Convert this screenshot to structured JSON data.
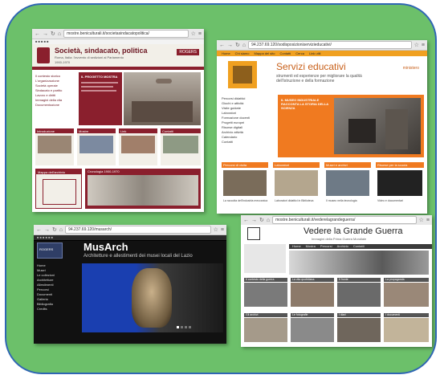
{
  "shots": {
    "politica": {
      "url": "mostre.beniculturali.it/societasindacatopolitica/",
      "title": "Società, sindacato, politica",
      "subtitle": "Roma, Italia: l'avvento di sedizioni al Parlamento",
      "years": "1900-1970",
      "logo": "ROGERS",
      "sidebar": [
        "Il contesto storico",
        "L'organizzazione",
        "Società operaie",
        "Sindacato e partito",
        "Lavoro e diritti",
        "Immagini della vita",
        "Documentazione"
      ],
      "box_title": "IL PROGETTO MOSTRA",
      "sections": [
        "Introduzione",
        "Mostre",
        "Link",
        "Contatti"
      ],
      "lower_left": "Mappa dell'archivio",
      "lower_right": "Cronologia 1900-1970"
    },
    "servizi": {
      "url": "94.237.69.120/sodisposizioniservizieducativi/",
      "title": "Servizi educativi",
      "subtitle": "strumenti ed esperienze per migliorare la qualità dell'istruzione e della formazione",
      "logo_text": "ministero",
      "menu": [
        "Home",
        "Chi siamo",
        "Mappa del sito",
        "Contatti",
        "Cerca",
        "Link utili"
      ],
      "sidebar": [
        "Percorsi didattici",
        "Giochi e attività",
        "Visite guidate",
        "Laboratori",
        "Formazione docenti",
        "Progetti europei",
        "Risorse digitali",
        "Archivio attività",
        "Calendario",
        "Contatti"
      ],
      "banner": "IL MUSEO INDUSTRIALE RACCONTA LA STORIA DELLA SCIENZA",
      "cards": [
        "Percorsi di visita",
        "Laboratori",
        "Musei e archivi",
        "Risorse per la scuola"
      ],
      "card_captions": [
        "La raccolta dell'industria meccanica",
        "Laboratori didattici in Biblioteca",
        "Il museo nella tecnologia",
        "Video e documentari"
      ]
    },
    "musarch": {
      "url": "94.237.69.120/musarch/",
      "logo": "ROGERS",
      "title": "MusArch",
      "subtitle": "Architetture e allestimenti dei musei locali del Lazio",
      "sidebar": [
        "Home",
        "Musei",
        "Le collezioni",
        "Architetture",
        "Allestimenti",
        "Percorsi",
        "Documenti",
        "Galleria",
        "Bibliografia",
        "Credits"
      ]
    },
    "guerra": {
      "url": "mostre.beniculturali.it/vederelagrandeguerra/",
      "title": "Vedere la Grande Guerra",
      "subtitle": "Immagini della Prima Guerra Mondiale",
      "menu": [
        "Home",
        "Mostra",
        "Percorsi",
        "Archivio",
        "Contatti"
      ],
      "row1": [
        "Il contesto della guerra",
        "La vita quotidiana",
        "Il fronte",
        "La propaganda"
      ],
      "row2": [
        "Gli archivi",
        "Le fotografie",
        "I diari",
        "I documenti"
      ]
    }
  }
}
